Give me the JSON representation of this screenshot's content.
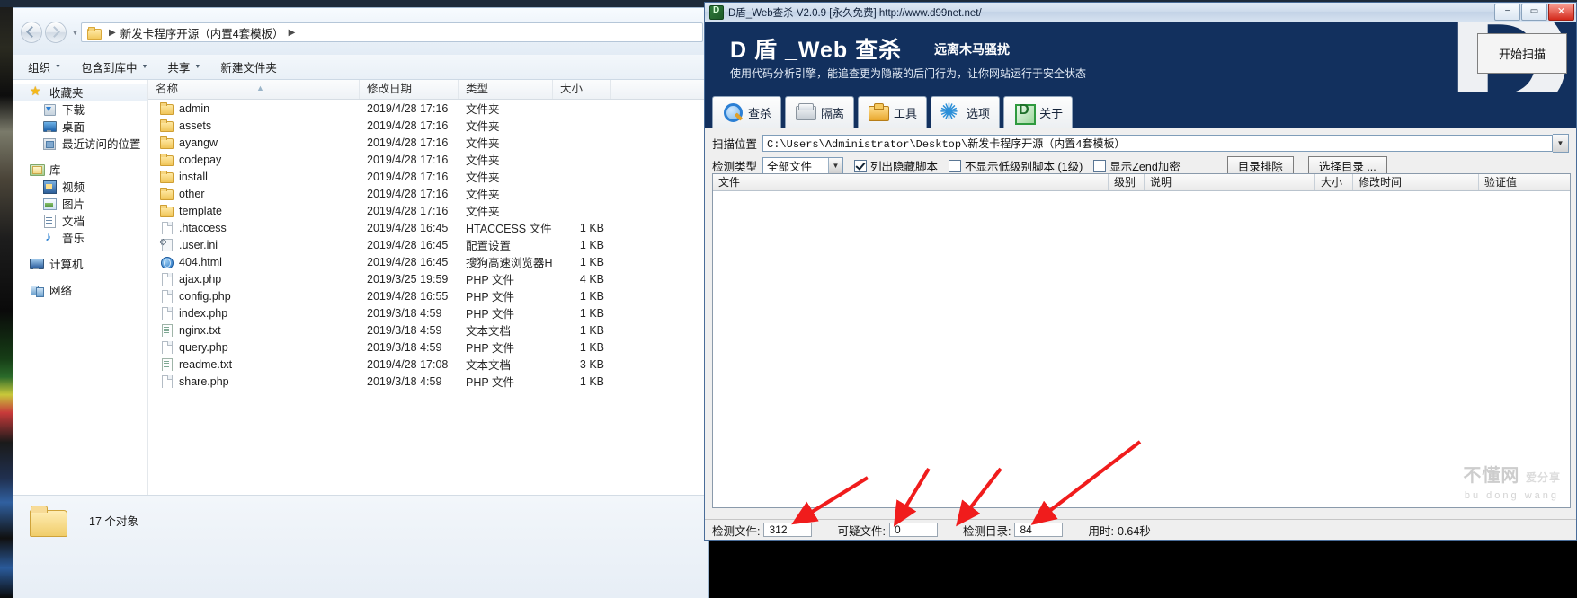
{
  "explorer": {
    "address": {
      "crumb_root": "新发卡程序开源（内置4套模板）",
      "sep": "▶"
    },
    "toolbar": [
      {
        "label": "组织",
        "caret": "▼"
      },
      {
        "label": "包含到库中",
        "caret": "▼"
      },
      {
        "label": "共享",
        "caret": "▼"
      },
      {
        "label": "新建文件夹",
        "caret": ""
      }
    ],
    "sidebar": [
      {
        "label": "收藏夹",
        "icon": "star-icon",
        "level": "root"
      },
      {
        "label": "下载",
        "icon": "download-icon",
        "level": "child"
      },
      {
        "label": "桌面",
        "icon": "desktop-icon",
        "level": "child"
      },
      {
        "label": "最近访问的位置",
        "icon": "recent-places-icon",
        "level": "child"
      },
      {
        "label": "库",
        "icon": "library-icon",
        "level": "root"
      },
      {
        "label": "视频",
        "icon": "video-icon",
        "level": "child"
      },
      {
        "label": "图片",
        "icon": "picture-icon",
        "level": "child"
      },
      {
        "label": "文档",
        "icon": "document-icon",
        "level": "child"
      },
      {
        "label": "音乐",
        "icon": "music-icon",
        "level": "child"
      },
      {
        "label": "计算机",
        "icon": "computer-icon",
        "level": "root"
      },
      {
        "label": "网络",
        "icon": "network-icon",
        "level": "root"
      }
    ],
    "columns": [
      "名称",
      "修改日期",
      "类型",
      "大小"
    ],
    "sort_indicator": "▲",
    "files": [
      {
        "name": "admin",
        "date": "2019/4/28 17:16",
        "type": "文件夹",
        "size": "",
        "icon": "folder-icon"
      },
      {
        "name": "assets",
        "date": "2019/4/28 17:16",
        "type": "文件夹",
        "size": "",
        "icon": "folder-icon"
      },
      {
        "name": "ayangw",
        "date": "2019/4/28 17:16",
        "type": "文件夹",
        "size": "",
        "icon": "folder-icon"
      },
      {
        "name": "codepay",
        "date": "2019/4/28 17:16",
        "type": "文件夹",
        "size": "",
        "icon": "folder-icon"
      },
      {
        "name": "install",
        "date": "2019/4/28 17:16",
        "type": "文件夹",
        "size": "",
        "icon": "folder-icon"
      },
      {
        "name": "other",
        "date": "2019/4/28 17:16",
        "type": "文件夹",
        "size": "",
        "icon": "folder-icon"
      },
      {
        "name": "template",
        "date": "2019/4/28 17:16",
        "type": "文件夹",
        "size": "",
        "icon": "folder-icon"
      },
      {
        "name": ".htaccess",
        "date": "2019/4/28 16:45",
        "type": "HTACCESS 文件",
        "size": "1 KB",
        "icon": "file-icon"
      },
      {
        "name": ".user.ini",
        "date": "2019/4/28 16:45",
        "type": "配置设置",
        "size": "1 KB",
        "icon": "ini-icon"
      },
      {
        "name": "404.html",
        "date": "2019/4/28 16:45",
        "type": "搜狗高速浏览器H...",
        "size": "1 KB",
        "icon": "html-icon"
      },
      {
        "name": "ajax.php",
        "date": "2019/3/25 19:59",
        "type": "PHP 文件",
        "size": "4 KB",
        "icon": "file-icon"
      },
      {
        "name": "config.php",
        "date": "2019/4/28 16:55",
        "type": "PHP 文件",
        "size": "1 KB",
        "icon": "file-icon"
      },
      {
        "name": "index.php",
        "date": "2019/3/18 4:59",
        "type": "PHP 文件",
        "size": "1 KB",
        "icon": "file-icon"
      },
      {
        "name": "nginx.txt",
        "date": "2019/3/18 4:59",
        "type": "文本文档",
        "size": "1 KB",
        "icon": "txt-icon"
      },
      {
        "name": "query.php",
        "date": "2019/3/18 4:59",
        "type": "PHP 文件",
        "size": "1 KB",
        "icon": "file-icon"
      },
      {
        "name": "readme.txt",
        "date": "2019/4/28 17:08",
        "type": "文本文档",
        "size": "3 KB",
        "icon": "txt-icon"
      },
      {
        "name": "share.php",
        "date": "2019/3/18 4:59",
        "type": "PHP 文件",
        "size": "1 KB",
        "icon": "file-icon"
      }
    ],
    "status": "17 个对象"
  },
  "dshield": {
    "titlebar": {
      "title": "D盾_Web查杀 V2.0.9 [永久免费] http://www.d99net.net/",
      "minimize": "−",
      "maximize": "▭",
      "close": "✕"
    },
    "banner": {
      "brand": "D 盾 _Web 查杀",
      "slogan": "远离木马骚扰",
      "desc": "使用代码分析引擎，能追查更为隐蔽的后门行为，让你网站运行于安全状态",
      "watermark_letter": "D"
    },
    "tabs": [
      {
        "label": "查杀",
        "icon": "magnifier-icon",
        "active": true
      },
      {
        "label": "隔离",
        "icon": "box-icon",
        "active": false
      },
      {
        "label": "工具",
        "icon": "toolbox-icon",
        "active": false
      },
      {
        "label": "选项",
        "icon": "gear-icon",
        "active": false
      },
      {
        "label": "关于",
        "icon": "dshield-logo-icon",
        "active": false
      }
    ],
    "options": {
      "scan_path_label": "扫描位置",
      "scan_path_value": "C:\\Users\\Administrator\\Desktop\\新发卡程序开源（内置4套模板）",
      "scan_path_dropdown": "▼",
      "detect_type_label": "检测类型",
      "detect_type_value": "全部文件",
      "detect_type_dropdown": "▼",
      "checkboxes": [
        {
          "label": "列出隐藏脚本",
          "checked": true
        },
        {
          "label": "不显示低级别脚本 (1级)",
          "checked": false
        },
        {
          "label": "显示Zend加密",
          "checked": false
        }
      ],
      "exclude_dir_button": "目录排除",
      "select_dir_button": "选择目录 ...",
      "start_scan_button": "开始扫描"
    },
    "grid_columns": [
      "文件",
      "级别",
      "说明",
      "大小",
      "修改时间",
      "验证值"
    ],
    "grid_rows": [],
    "statusbar": {
      "scanned_files_label": "检测文件:",
      "scanned_files_value": "312",
      "suspicious_files_label": "可疑文件:",
      "suspicious_files_value": "0",
      "scanned_dirs_label": "检测目录:",
      "scanned_dirs_value": "84",
      "elapsed_label": "用时:",
      "elapsed_value": "0.64秒"
    },
    "watermark": {
      "main": "不懂网",
      "sub": "爱分享",
      "footer": "bu dong wang"
    }
  }
}
